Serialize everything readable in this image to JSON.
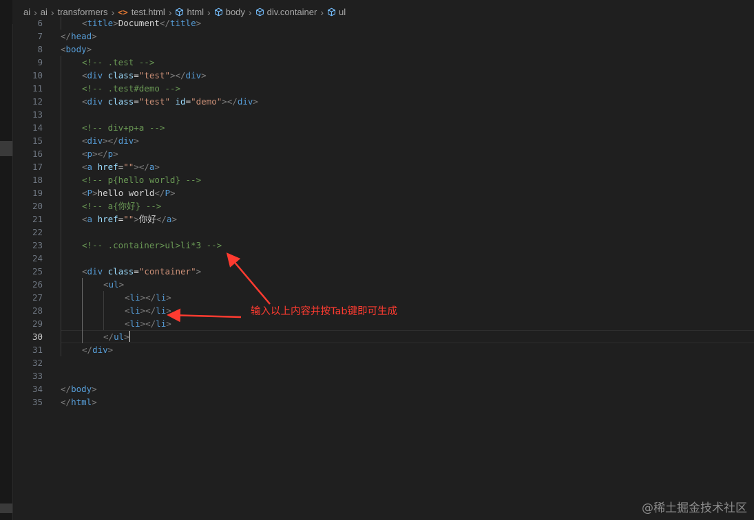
{
  "breadcrumb": [
    {
      "label": "ai",
      "icon": ""
    },
    {
      "label": "ai",
      "icon": ""
    },
    {
      "label": "transformers",
      "icon": ""
    },
    {
      "label": "test.html",
      "icon": "html-file-icon"
    },
    {
      "label": "html",
      "icon": "element-cube-icon"
    },
    {
      "label": "body",
      "icon": "element-cube-icon"
    },
    {
      "label": "div.container",
      "icon": "element-cube-icon"
    },
    {
      "label": "ul",
      "icon": "element-cube-icon"
    }
  ],
  "editor": {
    "active_line": 30,
    "lines": [
      {
        "n": 6,
        "indent": 1,
        "tokens": [
          [
            "br",
            "<"
          ],
          [
            "tg",
            "title"
          ],
          [
            "br",
            ">"
          ],
          [
            "tx",
            "Document"
          ],
          [
            "br",
            "</"
          ],
          [
            "tg",
            "title"
          ],
          [
            "br",
            ">"
          ]
        ]
      },
      {
        "n": 7,
        "indent": 0,
        "tokens": [
          [
            "br",
            "</"
          ],
          [
            "tg",
            "head"
          ],
          [
            "br",
            ">"
          ]
        ]
      },
      {
        "n": 8,
        "indent": 0,
        "tokens": [
          [
            "br",
            "<"
          ],
          [
            "tg",
            "body"
          ],
          [
            "br",
            ">"
          ]
        ]
      },
      {
        "n": 9,
        "indent": 1,
        "tokens": [
          [
            "cm",
            "<!-- .test -->"
          ]
        ]
      },
      {
        "n": 10,
        "indent": 1,
        "tokens": [
          [
            "br",
            "<"
          ],
          [
            "tg",
            "div"
          ],
          [
            "tx",
            " "
          ],
          [
            "at",
            "class"
          ],
          [
            "tx",
            "="
          ],
          [
            "st",
            "\"test\""
          ],
          [
            "br",
            "></"
          ],
          [
            "tg",
            "div"
          ],
          [
            "br",
            ">"
          ]
        ]
      },
      {
        "n": 11,
        "indent": 1,
        "tokens": [
          [
            "cm",
            "<!-- .test#demo -->"
          ]
        ]
      },
      {
        "n": 12,
        "indent": 1,
        "tokens": [
          [
            "br",
            "<"
          ],
          [
            "tg",
            "div"
          ],
          [
            "tx",
            " "
          ],
          [
            "at",
            "class"
          ],
          [
            "tx",
            "="
          ],
          [
            "st",
            "\"test\""
          ],
          [
            "tx",
            " "
          ],
          [
            "at",
            "id"
          ],
          [
            "tx",
            "="
          ],
          [
            "st",
            "\"demo\""
          ],
          [
            "br",
            "></"
          ],
          [
            "tg",
            "div"
          ],
          [
            "br",
            ">"
          ]
        ]
      },
      {
        "n": 13,
        "indent": 0,
        "tokens": []
      },
      {
        "n": 14,
        "indent": 1,
        "tokens": [
          [
            "cm",
            "<!-- div+p+a -->"
          ]
        ]
      },
      {
        "n": 15,
        "indent": 1,
        "tokens": [
          [
            "br",
            "<"
          ],
          [
            "tg",
            "div"
          ],
          [
            "br",
            "></"
          ],
          [
            "tg",
            "div"
          ],
          [
            "br",
            ">"
          ]
        ]
      },
      {
        "n": 16,
        "indent": 1,
        "tokens": [
          [
            "br",
            "<"
          ],
          [
            "tg",
            "p"
          ],
          [
            "br",
            "></"
          ],
          [
            "tg",
            "p"
          ],
          [
            "br",
            ">"
          ]
        ]
      },
      {
        "n": 17,
        "indent": 1,
        "tokens": [
          [
            "br",
            "<"
          ],
          [
            "tg",
            "a"
          ],
          [
            "tx",
            " "
          ],
          [
            "at",
            "href"
          ],
          [
            "tx",
            "="
          ],
          [
            "st",
            "\"\""
          ],
          [
            "br",
            "></"
          ],
          [
            "tg",
            "a"
          ],
          [
            "br",
            ">"
          ]
        ]
      },
      {
        "n": 18,
        "indent": 1,
        "tokens": [
          [
            "cm",
            "<!-- p{hello world} -->"
          ]
        ]
      },
      {
        "n": 19,
        "indent": 1,
        "tokens": [
          [
            "br",
            "<"
          ],
          [
            "tg",
            "P"
          ],
          [
            "br",
            ">"
          ],
          [
            "tx",
            "hello world"
          ],
          [
            "br",
            "</"
          ],
          [
            "tg",
            "P"
          ],
          [
            "br",
            ">"
          ]
        ]
      },
      {
        "n": 20,
        "indent": 1,
        "tokens": [
          [
            "cm",
            "<!-- a{你好} -->"
          ]
        ]
      },
      {
        "n": 21,
        "indent": 1,
        "tokens": [
          [
            "br",
            "<"
          ],
          [
            "tg",
            "a"
          ],
          [
            "tx",
            " "
          ],
          [
            "at",
            "href"
          ],
          [
            "tx",
            "="
          ],
          [
            "st",
            "\"\""
          ],
          [
            "br",
            ">"
          ],
          [
            "tx",
            "你好"
          ],
          [
            "br",
            "</"
          ],
          [
            "tg",
            "a"
          ],
          [
            "br",
            ">"
          ]
        ]
      },
      {
        "n": 22,
        "indent": 0,
        "tokens": []
      },
      {
        "n": 23,
        "indent": 1,
        "tokens": [
          [
            "cm",
            "<!-- .container>ul>li*3 -->"
          ]
        ]
      },
      {
        "n": 24,
        "indent": 0,
        "tokens": []
      },
      {
        "n": 25,
        "indent": 1,
        "tokens": [
          [
            "br",
            "<"
          ],
          [
            "tg",
            "div"
          ],
          [
            "tx",
            " "
          ],
          [
            "at",
            "class"
          ],
          [
            "tx",
            "="
          ],
          [
            "st",
            "\"container\""
          ],
          [
            "br",
            ">"
          ]
        ]
      },
      {
        "n": 26,
        "indent": 2,
        "tokens": [
          [
            "br",
            "<"
          ],
          [
            "tg",
            "ul"
          ],
          [
            "br",
            ">"
          ]
        ]
      },
      {
        "n": 27,
        "indent": 3,
        "tokens": [
          [
            "br",
            "<"
          ],
          [
            "tg",
            "li"
          ],
          [
            "br",
            "></"
          ],
          [
            "tg",
            "li"
          ],
          [
            "br",
            ">"
          ]
        ]
      },
      {
        "n": 28,
        "indent": 3,
        "tokens": [
          [
            "br",
            "<"
          ],
          [
            "tg",
            "li"
          ],
          [
            "br",
            "></"
          ],
          [
            "tg",
            "li"
          ],
          [
            "br",
            ">"
          ]
        ]
      },
      {
        "n": 29,
        "indent": 3,
        "tokens": [
          [
            "br",
            "<"
          ],
          [
            "tg",
            "li"
          ],
          [
            "br",
            "></"
          ],
          [
            "tg",
            "li"
          ],
          [
            "br",
            ">"
          ]
        ]
      },
      {
        "n": 30,
        "indent": 2,
        "tokens": [
          [
            "br",
            "</"
          ],
          [
            "tg",
            "ul"
          ],
          [
            "br",
            ">"
          ]
        ]
      },
      {
        "n": 31,
        "indent": 1,
        "tokens": [
          [
            "br",
            "</"
          ],
          [
            "tg",
            "div"
          ],
          [
            "br",
            ">"
          ]
        ]
      },
      {
        "n": 32,
        "indent": 0,
        "tokens": []
      },
      {
        "n": 33,
        "indent": 0,
        "tokens": []
      },
      {
        "n": 34,
        "indent": 0,
        "tokens": [
          [
            "br",
            "</"
          ],
          [
            "tg",
            "body"
          ],
          [
            "br",
            ">"
          ]
        ]
      },
      {
        "n": 35,
        "indent": 0,
        "tokens": [
          [
            "br",
            "</"
          ],
          [
            "tg",
            "html"
          ],
          [
            "br",
            ">"
          ]
        ]
      }
    ]
  },
  "annotation": {
    "text": "输入以上内容并按Tab键即可生成",
    "color": "#ff3b30"
  },
  "watermark": "@稀土掘金技术社区",
  "colors": {
    "tag": "#569cd6",
    "bracket": "#808080",
    "attr": "#9cdcfe",
    "string": "#ce9178",
    "comment": "#6a9955",
    "text": "#d4d4d4"
  }
}
